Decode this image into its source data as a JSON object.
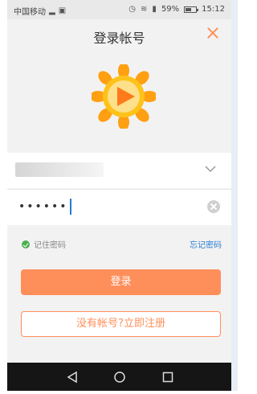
{
  "status_bar": {
    "carrier": "中国移动",
    "battery_percent": "59%",
    "battery_level": 0.59,
    "time": "15:12"
  },
  "header": {
    "title": "登录帐号"
  },
  "form": {
    "password_mask": "••••••"
  },
  "options": {
    "remember_label": "记住密码",
    "forgot_label": "忘记密码"
  },
  "buttons": {
    "login_label": "登录",
    "register_label": "没有帐号?立即注册"
  },
  "colors": {
    "accent": "#ff8f5a",
    "link": "#2a7fd4",
    "check": "#4caf50"
  }
}
